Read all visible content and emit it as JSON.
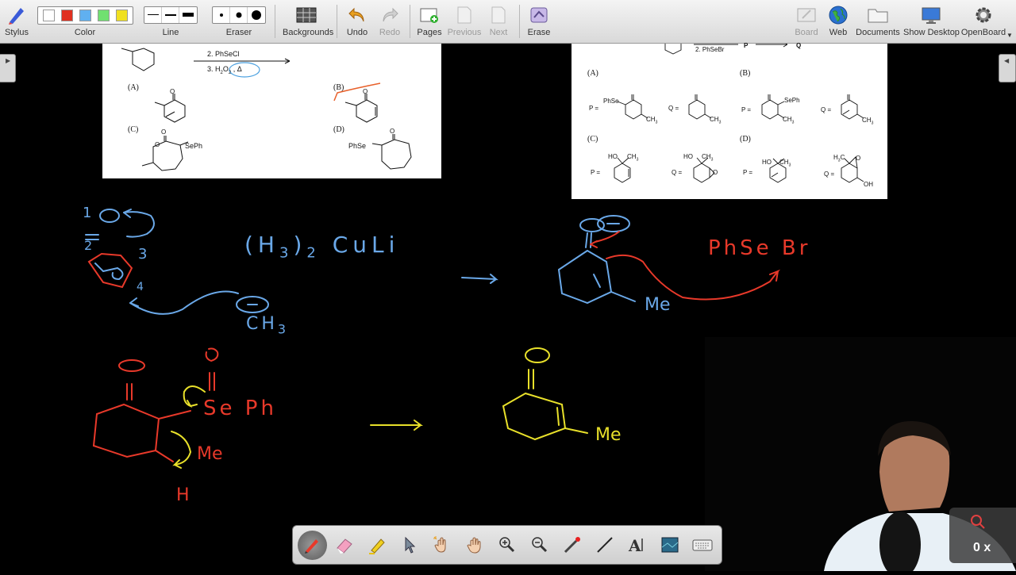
{
  "toolbar": {
    "stylus": "Stylus",
    "color": "Color",
    "line": "Line",
    "eraser": "Eraser",
    "backgrounds": "Backgrounds",
    "undo": "Undo",
    "redo": "Redo",
    "pages": "Pages",
    "previous": "Previous",
    "next": "Next",
    "erase": "Erase",
    "board": "Board",
    "web": "Web",
    "documents": "Documents",
    "show_desktop": "Show Desktop",
    "openboard": "OpenBoard",
    "palette": [
      "#ffffff",
      "#e03020",
      "#60b0f0",
      "#70e070",
      "#f0e020"
    ]
  },
  "question_left": {
    "step2": "2. PhSeCl",
    "step3": "3. H",
    "step3_b": "2",
    "step3_c": "O",
    "step3_d": "2",
    "step3_e": " , Δ",
    "opt_a": "(A)",
    "opt_b": "(B)",
    "opt_c": "(C)",
    "opt_d": "(D)",
    "seph_c": "SePh",
    "phse_d": "PhSe"
  },
  "question_right": {
    "step2": "2. PhSeBr",
    "p_arrow": "P",
    "q_arrow": "Q",
    "opt_a": "(A)",
    "opt_b": "(B)",
    "opt_c": "(C)",
    "opt_d": "(D)",
    "p_eq": "P =",
    "q_eq": "Q =",
    "phse": "PhSe",
    "seph": "SePh",
    "ch3": "CH",
    "ch3_sub": "3",
    "ho": "HO",
    "oh": "OH",
    "h3c": "H",
    "o": "O"
  },
  "ink": {
    "num1": "1",
    "num2": "2",
    "num3": "3",
    "num4": "4",
    "reagent": "(H",
    "reagent_sub": "3",
    "reagent_paren": ")",
    "reagent_sub2": "2",
    "reagent_tail": "CuLi",
    "ch3": "CH",
    "ch3_sub": "3",
    "phsebr": "PhSe Br",
    "me1": "Me",
    "seph": "Se Ph",
    "me2": "Me",
    "h": "H",
    "me3": "Me"
  },
  "bottom_tools": [
    "pen",
    "eraser",
    "highlighter",
    "selector",
    "interactor",
    "hand",
    "zoom-in",
    "zoom-out",
    "laser",
    "line",
    "text",
    "capture",
    "keyboard"
  ],
  "zoom_indicator": "0 x",
  "colors": {
    "ink_blue": "#6aa8e8",
    "ink_red": "#e8392a",
    "ink_yellow": "#e8e02a",
    "check_orange": "#e8602a"
  }
}
